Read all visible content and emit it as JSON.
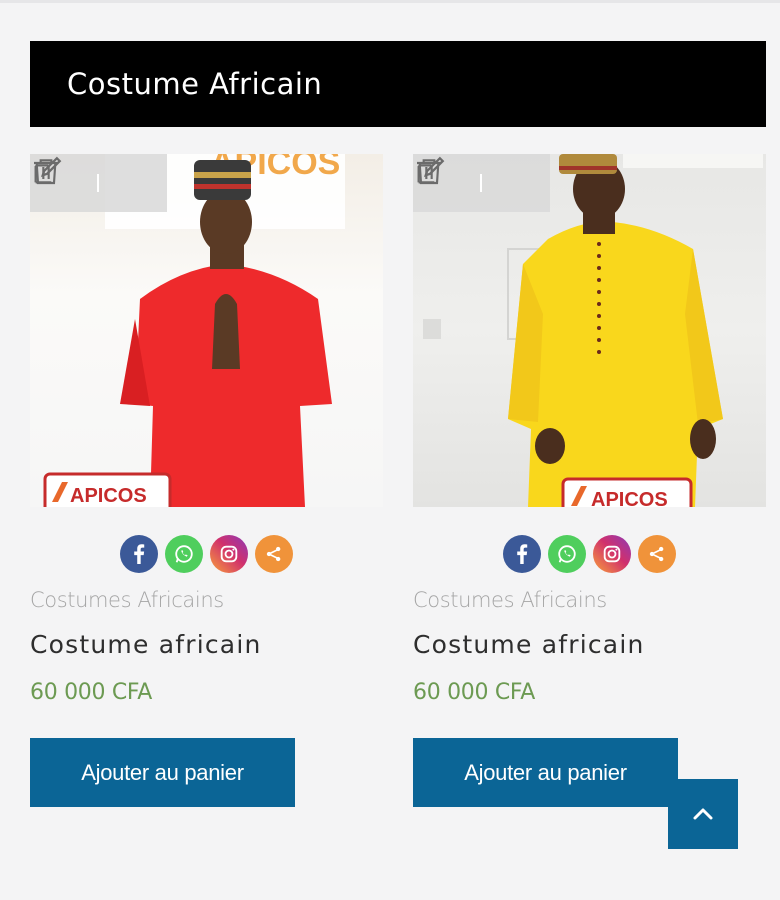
{
  "section": {
    "title": "Costume Africain"
  },
  "colors": {
    "header_bg": "#000000",
    "button_bg": "#0b6596",
    "price": "#6c9a52",
    "facebook": "#3b5998",
    "whatsapp": "#4fce5d",
    "instagram": "#c13584",
    "share": "#f0933a"
  },
  "products": [
    {
      "category": "Costumes Africains",
      "title": "Costume africain",
      "price": "60 000 CFA",
      "cart_label": "Ajouter au panier",
      "photo_logo": "APICOS",
      "garment_color": "red"
    },
    {
      "category": "Costumes Africains",
      "title": "Costume africain",
      "price": "60 000 CFA",
      "cart_label": "Ajouter au panier",
      "photo_logo": "APICOS",
      "garment_color": "yellow"
    }
  ],
  "icons": {
    "edit": "edit-icon",
    "delete": "trash-icon",
    "facebook": "facebook-icon",
    "whatsapp": "whatsapp-icon",
    "instagram": "instagram-icon",
    "share": "share-icon",
    "scroll_top": "chevron-up-icon"
  }
}
